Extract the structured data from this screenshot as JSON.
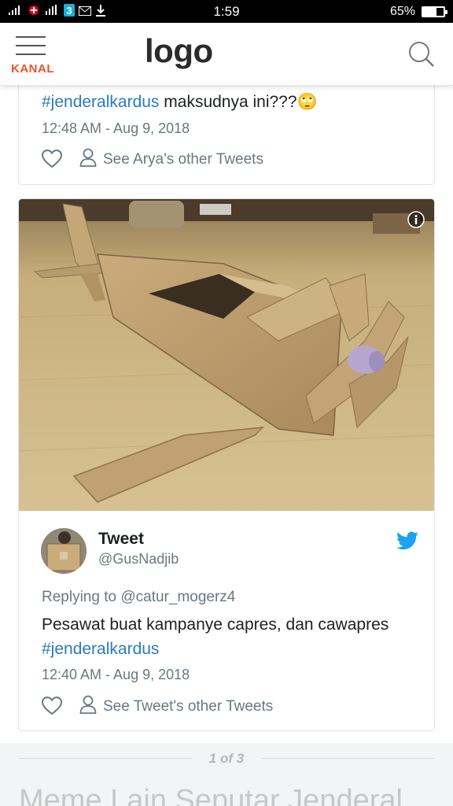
{
  "status_bar": {
    "time": "1:59",
    "battery_percent": "65%",
    "battery_level": 0.65
  },
  "header": {
    "menu_label": "KANAL",
    "logo_text": "logo",
    "menu_icon": "hamburger-icon",
    "search_icon": "search-icon"
  },
  "tweet1": {
    "hashtag": "#jenderalkardus",
    "text": " maksudnya ini???",
    "emoji": "🙄",
    "time": "12:48 AM - Aug 9, 2018",
    "see_other": "See Arya's other Tweets"
  },
  "tweet2": {
    "author_name": "Tweet",
    "author_handle": "@GusNadjib",
    "replying_prefix": "Replying to ",
    "replying_to": "@catur_mogerz4",
    "text": "Pesawat buat kampanye capres, dan cawapres",
    "hashtag": "#jenderalkardus",
    "time": "12:40 AM - Aug 9, 2018",
    "see_other": "See Tweet's other Tweets"
  },
  "gallery": {
    "pager": "1 of 3",
    "next_heading": "Meme Lain Seputar Jenderal"
  },
  "colors": {
    "accent_kanal": "#e8542b",
    "link": "#2b7bb9",
    "muted": "#697882",
    "twitter": "#1da1f2"
  }
}
